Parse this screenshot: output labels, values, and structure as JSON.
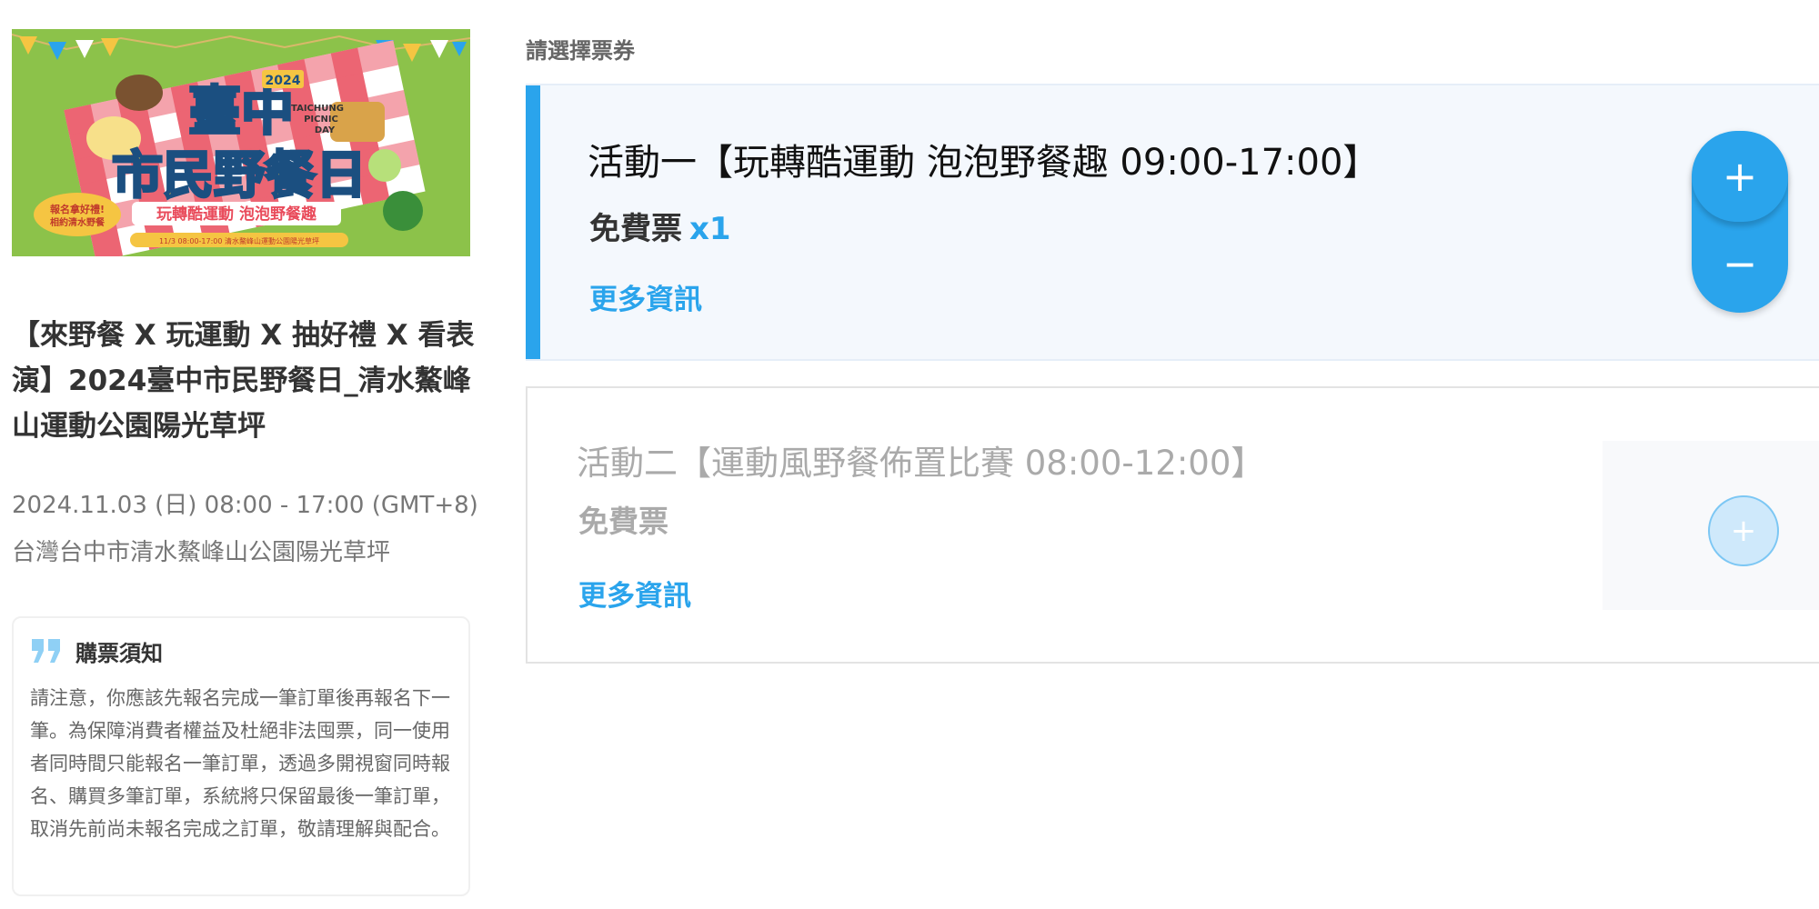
{
  "banner": {
    "title_lines": [
      "臺中",
      "市民野餐日"
    ],
    "year": "2024",
    "english": "TAICHUNG PICNIC DAY",
    "slogan": "玩轉酷運動 泡泡野餐趣",
    "badge": "報名拿好禮! 相約清水野餐",
    "info": "11/3 ⓓ08:00-17:00 ⓥ清水鰲峰山運動公園陽光草坪",
    "colors": {
      "grass": "#8cc24a",
      "cloth_red": "#e94b5b",
      "title_blue": "#2aa4ec"
    }
  },
  "event": {
    "title": "【來野餐 X 玩運動 X 抽好禮 X 看表演】2024臺中市民野餐日_清水鰲峰山運動公園陽光草坪",
    "date": "2024.11.03 (日) 08:00 - 17:00 (GMT+8)",
    "venue": "台灣台中市清水鰲峰山公園陽光草坪"
  },
  "notice": {
    "icon": "quote-icon",
    "title": "購票須知",
    "body": "請注意，你應該先報名完成一筆訂單後再報名下一筆。為保障消費者權益及杜絕非法囤票，同一使用者同時間只能報名一筆訂單，透過多開視窗同時報名、購買多筆訂單，系統將只保留最後一筆訂單，取消先前尚未報名完成之訂單，敬請理解與配合。"
  },
  "tickets": {
    "label": "請選擇票券",
    "items": [
      {
        "name": "活動一【玩轉酷運動 泡泡野餐趣 09:00-17:00】",
        "type": "免費票",
        "qty": "x1",
        "more": "更多資訊",
        "plus": "+",
        "minus": "−"
      },
      {
        "name": "活動二【運動風野餐佈置比賽 08:00-12:00】",
        "type": "免費票",
        "more": "更多資訊",
        "plus": "+"
      }
    ]
  },
  "colors": {
    "accent": "#2aa4ec",
    "selected_bg": "#f4f8fd"
  }
}
